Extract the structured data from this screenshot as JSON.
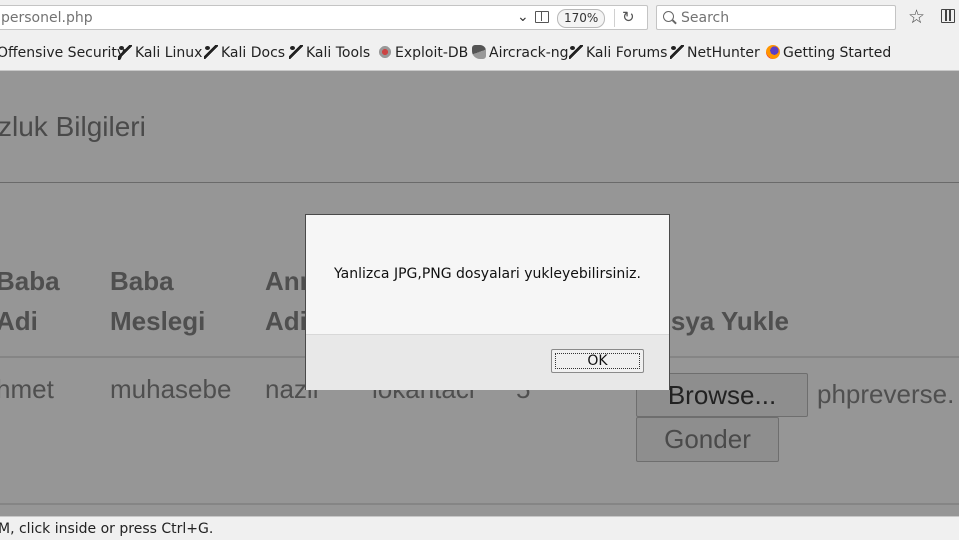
{
  "browser": {
    "url": "personel.php",
    "zoom": "170%",
    "search_placeholder": "Search"
  },
  "bookmarks": [
    {
      "label": "Offensive Security"
    },
    {
      "label": "Kali Linux",
      "icon": "kali-dragon-icon"
    },
    {
      "label": "Kali Docs",
      "icon": "kali-dragon-icon"
    },
    {
      "label": "Kali Tools",
      "icon": "kali-dragon-icon"
    },
    {
      "label": "Exploit-DB",
      "icon": "exploit-db-icon"
    },
    {
      "label": "Aircrack-ng",
      "icon": "aircrack-icon"
    },
    {
      "label": "Kali Forums",
      "icon": "kali-dragon-icon"
    },
    {
      "label": "NetHunter",
      "icon": "kali-dragon-icon"
    },
    {
      "label": "Getting Started",
      "icon": "firefox-icon"
    }
  ],
  "page": {
    "title": "zluk Bilgileri",
    "headers": [
      {
        "line1": "Baba",
        "line2": "Adi"
      },
      {
        "line1": "Baba",
        "line2": "Meslegi"
      },
      {
        "line1": "Ann",
        "line2": "Adi"
      },
      {
        "line1": "",
        "line2": "osya Yukle"
      }
    ],
    "row": [
      "hmet",
      "muhasebe",
      "nazli",
      "lokantaci",
      "5"
    ],
    "browse_label": "Browse...",
    "file_name": "phpreverse.",
    "submit_label": "Gonder"
  },
  "dialog": {
    "message": "Yanlizca JPG,PNG dosyalari yukleyebilirsiniz.",
    "ok_label": "OK"
  },
  "statusbar": {
    "text": "M, click inside or press Ctrl+G."
  }
}
